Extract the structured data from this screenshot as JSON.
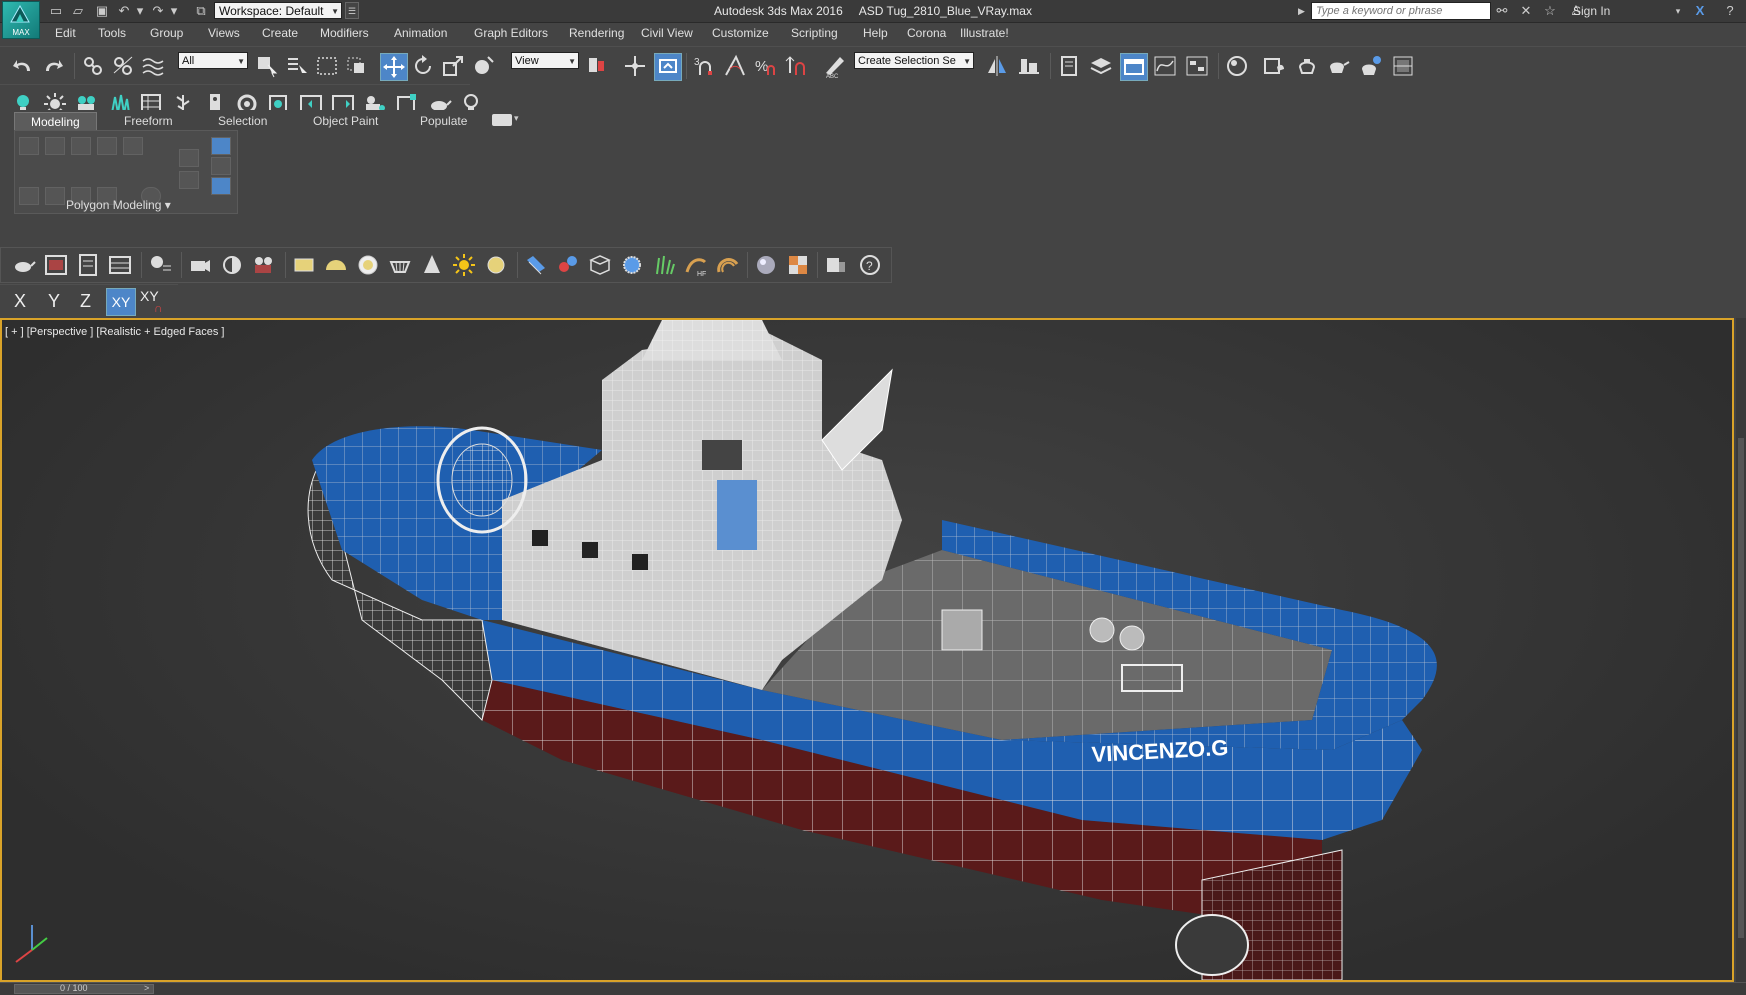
{
  "titlebar": {
    "workspace": "Workspace: Default",
    "app_name": "Autodesk 3ds Max 2016",
    "file_name": "ASD Tug_2810_Blue_VRay.max",
    "search_placeholder": "Type a keyword or phrase",
    "sign_in": "Sign In",
    "logo_text": "MAX"
  },
  "menu": [
    "Edit",
    "Tools",
    "Group",
    "Views",
    "Create",
    "Modifiers",
    "Animation",
    "Graph Editors",
    "Rendering",
    "Civil View",
    "Customize",
    "Scripting",
    "Help",
    "Corona",
    "Illustrate!"
  ],
  "main_toolbar": {
    "selection_filter": "All",
    "ref_coord": "View",
    "named_selection": "Create Selection Se"
  },
  "ribbon": {
    "tabs": [
      "Modeling",
      "Freeform",
      "Selection",
      "Object Paint",
      "Populate"
    ],
    "active_tab": "Modeling",
    "panel_label": "Polygon Modeling"
  },
  "axis_constraints": [
    "X",
    "Y",
    "Z",
    "XY",
    "XY"
  ],
  "viewport": {
    "label": "[ + ] [Perspective ] [Realistic + Edged Faces ]",
    "hull_name": "VINCENZO.G"
  },
  "timeline": {
    "frame": "0 / 100"
  },
  "colors": {
    "active_viewport_border": "#d9a329",
    "hull_blue": "#1f5fb0",
    "hull_red": "#5a1a1a"
  }
}
